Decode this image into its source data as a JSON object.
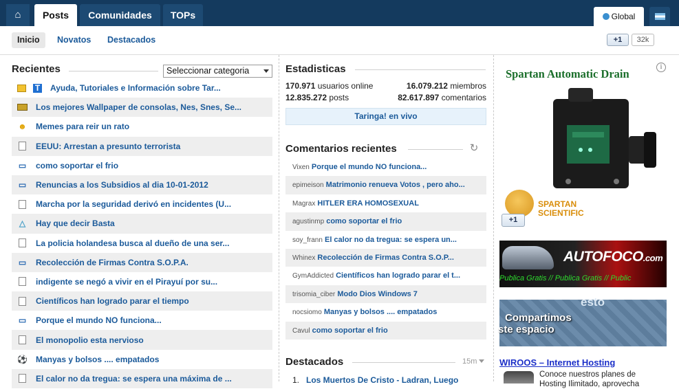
{
  "topnav": {
    "home_icon": "home-icon",
    "tabs": [
      {
        "label": "Posts",
        "active": true
      },
      {
        "label": "Comunidades",
        "active": false
      },
      {
        "label": "TOPs",
        "active": false
      }
    ],
    "global_label": "Global",
    "flag_icon": "argentina-flag-icon"
  },
  "subnav": {
    "items": [
      {
        "label": "Inicio",
        "selected": true
      },
      {
        "label": "Novatos",
        "selected": false
      },
      {
        "label": "Destacados",
        "selected": false
      }
    ],
    "plusone_label": "+1",
    "plusone_count": "32k"
  },
  "recientes": {
    "title": "Recientes",
    "category_select": "Seleccionar categoria",
    "items": [
      {
        "icon": "folder-icon",
        "icon2": "t-icon",
        "title": "Ayuda, Tutoriales e Información sobre Tar..."
      },
      {
        "icon": "wallpaper-icon",
        "title": "Los mejores Wallpaper de consolas, Nes, Snes, Se..."
      },
      {
        "icon": "smiley-icon",
        "title": "Memes para reir un rato"
      },
      {
        "icon": "document-icon",
        "title": "EEUU: Arrestan a presunto terrorista"
      },
      {
        "icon": "book-icon",
        "title": "como soportar el frio"
      },
      {
        "icon": "book-icon",
        "title": "Renuncias a los Subsidios al dia 10-01-2012"
      },
      {
        "icon": "document-icon",
        "title": "Marcha por la seguridad derivó en incidentes (U..."
      },
      {
        "icon": "flask-icon",
        "title": "Hay que decir Basta"
      },
      {
        "icon": "document-icon",
        "title": "La policia holandesa busca al dueño de una ser..."
      },
      {
        "icon": "book-icon",
        "title": "Recolección de Firmas Contra S.O.P.A."
      },
      {
        "icon": "document-icon",
        "title": "indigente se negó a vivir en el Pirayuí por su..."
      },
      {
        "icon": "document-icon",
        "title": "Científicos han logrado parar el tiempo"
      },
      {
        "icon": "book-icon",
        "title": "Porque el mundo NO funciona..."
      },
      {
        "icon": "document-icon",
        "title": "El monopolio esta nervioso"
      },
      {
        "icon": "soccer-ball-icon",
        "title": "Manyas y bolsos .... empatados"
      },
      {
        "icon": "document-icon",
        "title": "El calor no da tregua: se espera una máxima de ..."
      }
    ]
  },
  "estadisticas": {
    "title": "Estadisticas",
    "online_value": "170.971",
    "online_label": "usuarios online",
    "members_value": "16.079.212",
    "members_label": "miembros",
    "posts_value": "12.835.272",
    "posts_label": "posts",
    "comments_value": "82.617.897",
    "comments_label": "comentarios",
    "live_link": "Taringa! en vivo"
  },
  "comentarios": {
    "title": "Comentarios recientes",
    "refresh_icon": "refresh-icon",
    "items": [
      {
        "user": "Vixen",
        "post": "Porque el mundo NO funciona..."
      },
      {
        "user": "epimeison",
        "post": "Matrimonio renueva Votos , pero aho..."
      },
      {
        "user": "Magrax",
        "post": "HITLER ERA HOMOSEXUAL"
      },
      {
        "user": "agustinmp",
        "post": "como soportar el frio"
      },
      {
        "user": "soy_frann",
        "post": "El calor no da tregua: se espera un..."
      },
      {
        "user": "Whinex",
        "post": "Recolección de Firmas Contra S.O.P..."
      },
      {
        "user": "GymAddicted",
        "post": "Científicos han logrado parar el t..."
      },
      {
        "user": "trisomia_ciber",
        "post": "Modo Dios Windows 7"
      },
      {
        "user": "nocsiomo",
        "post": "Manyas y bolsos .... empatados"
      },
      {
        "user": "Cavul",
        "post": "como soportar el frio"
      }
    ]
  },
  "destacados": {
    "title": "Destacados",
    "time_filter": "15m",
    "first_number": "1.",
    "first_item": "Los Muertos De Cristo - Ladran, Luego"
  },
  "ads": {
    "spartan_title": "Spartan Automatic Drain",
    "spartan_brand_line1": "SPARTAN",
    "spartan_brand_line2": "SCIENTIFIC",
    "spartan_plusone": "+1",
    "autofoco_logo_main": "AUTOFOCO",
    "autofoco_logo_suffix": ".com",
    "autofoco_strip": "Publica Gratis // Publica Gratis // Public",
    "compartimos_line1": "Compartimos",
    "compartimos_line2": "ste espacio",
    "compartimos_top": "esto",
    "wiroos_title": "WIROOS – Internet Hosting",
    "wiroos_line1": "Conoce nuestros planes de",
    "wiroos_line2": "Hosting Ilimitado, aprovecha"
  }
}
